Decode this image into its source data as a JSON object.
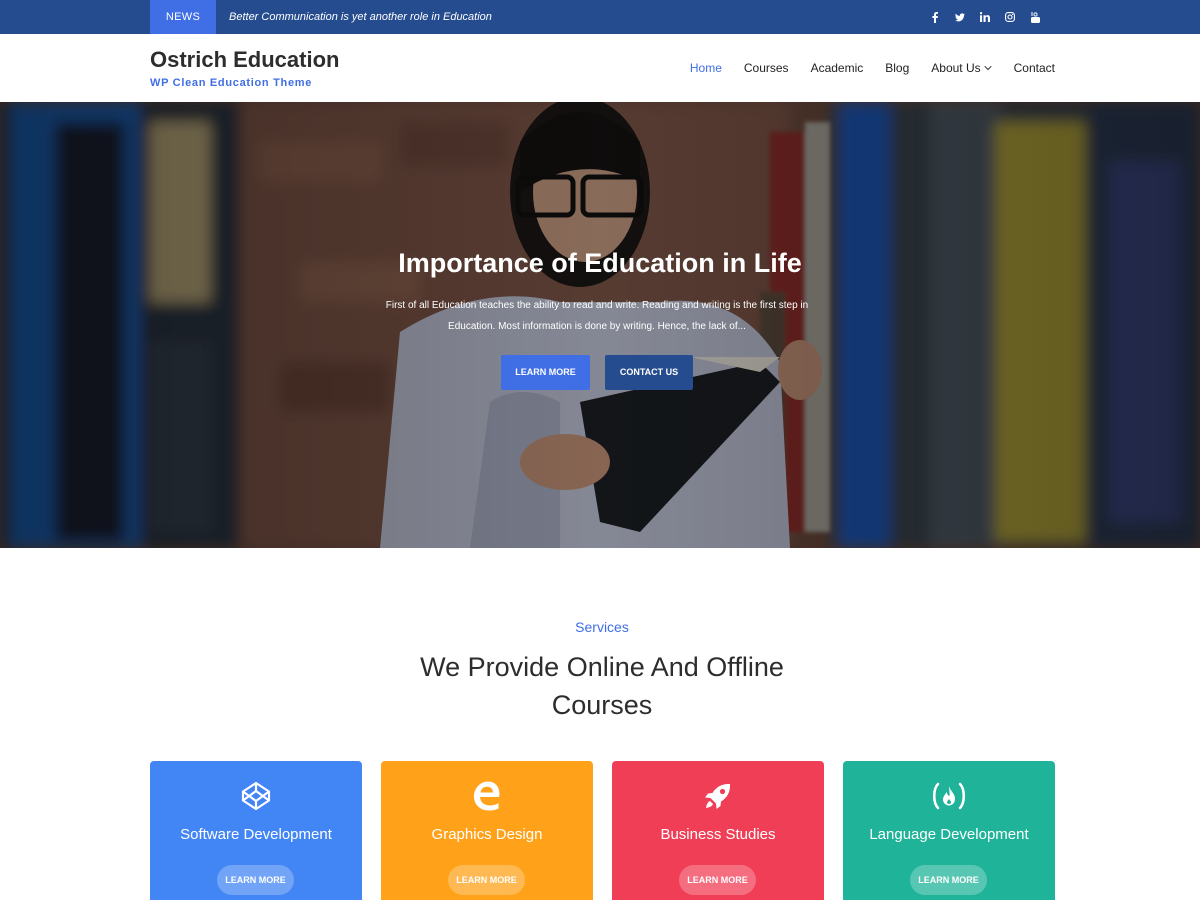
{
  "topbar": {
    "news_label": "NEWS",
    "news_text": "Better Communication is yet another role in Education",
    "social_icons": [
      "facebook-icon",
      "twitter-icon",
      "linkedin-icon",
      "instagram-icon",
      "youtube-icon"
    ]
  },
  "header": {
    "site_title": "Ostrich Education",
    "tagline": "WP Clean Education Theme",
    "nav": [
      {
        "label": "Home",
        "active": true
      },
      {
        "label": "Courses"
      },
      {
        "label": "Academic"
      },
      {
        "label": "Blog"
      },
      {
        "label": "About Us",
        "has_dropdown": true
      },
      {
        "label": "Contact"
      }
    ]
  },
  "hero": {
    "title": "Importance of Education in Life",
    "description": "First of all Education teaches the ability to read and write. Reading and writing is the first step in Education. Most information is done by writing. Hence, the lack of...",
    "learn_more": "LEARN MORE",
    "contact_us": "CONTACT US"
  },
  "services": {
    "eyebrow": "Services",
    "heading": "We Provide Online And Offline Courses",
    "cards": [
      {
        "title": "Software Development",
        "button": "LEARN MORE",
        "icon": "codepen-icon",
        "color": "#4285f4"
      },
      {
        "title": "Graphics Design",
        "button": "LEARN MORE",
        "icon": "edge-icon",
        "color": "#ffa21a"
      },
      {
        "title": "Business Studies",
        "button": "LEARN MORE",
        "icon": "rocket-icon",
        "color": "#f03e56"
      },
      {
        "title": "Language Development",
        "button": "LEARN MORE",
        "icon": "freecodecamp-icon",
        "color": "#1fb39a"
      }
    ]
  },
  "colors": {
    "primary": "#3f6ee5",
    "dark_blue": "#254c8e"
  }
}
